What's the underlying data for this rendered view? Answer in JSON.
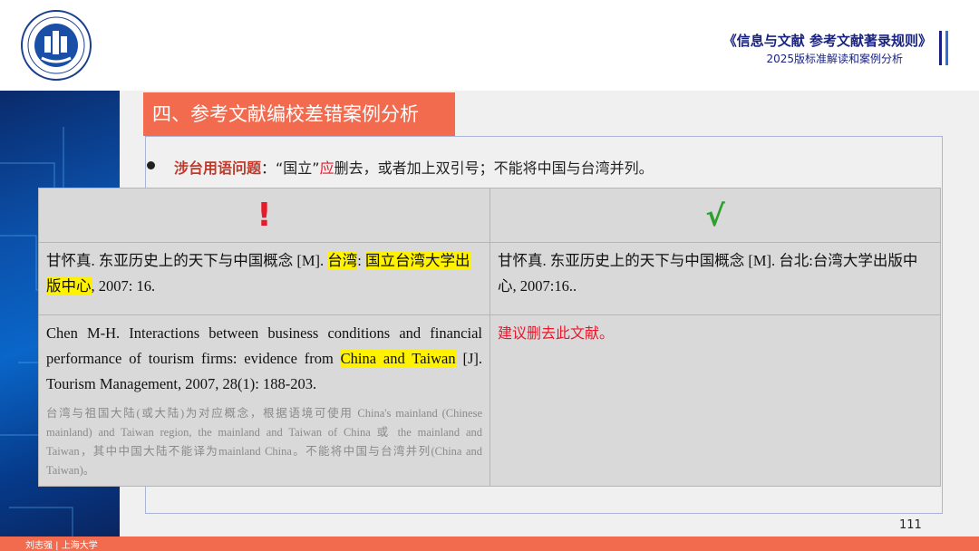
{
  "header": {
    "title": "《信息与文献  参考文献著录规则》",
    "subtitle": "2025版标准解读和案例分析"
  },
  "section": {
    "title": "四、参考文献编校差错案例分析"
  },
  "bullet": {
    "keyword": "涉台用语问题",
    "text_a": "：“国立”",
    "text_red": "应",
    "text_b": "删去，或者加上双引号；不能将中国与台湾并列。"
  },
  "table": {
    "header_wrong": "!",
    "header_right": "√",
    "row1": {
      "wrong": {
        "t1": "甘怀真. 东亚历史上的天下与中国概念 [M]. ",
        "hl1": "台湾",
        "t2": ": ",
        "hl2": "国立台湾大学出版中心",
        "t3": ", 2007: 16."
      },
      "right": "甘怀真. 东亚历史上的天下与中国概念 [M]. 台北:台湾大学出版中心, 2007:16.."
    },
    "row2": {
      "wrong": {
        "t1": "Chen M-H. Interactions between business conditions and financial performance of tourism firms: evidence from ",
        "hl1": "China and Taiwan",
        "t2": " [J]. Tourism Management, 2007, 28(1): 188-203.",
        "note": "台湾与祖国大陆(或大陆)为对应概念，根据语境可使用 China's mainland (Chinese mainland) and Taiwan region, the mainland and Taiwan of China 或 the mainland and Taiwan，其中中国大陆不能译为mainland China。不能将中国与台湾并列(China and Taiwan)。"
      },
      "right": "建议删去此文献。"
    }
  },
  "page_number": "111",
  "footer": "刘志强 | 上海大学",
  "colors": {
    "navy": "#1a2380",
    "accent_orange": "#f26b4f",
    "error_red": "#e8192c",
    "ok_green": "#2ca02c",
    "highlight": "#fff200"
  }
}
